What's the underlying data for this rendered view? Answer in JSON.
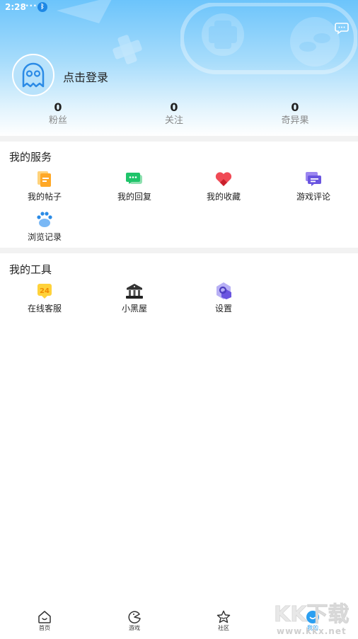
{
  "status_bar": {
    "time": "2:28",
    "dots": "···",
    "bluetooth_icon": "bluetooth-icon"
  },
  "header": {
    "message_icon": "chat-bubble-icon",
    "login_text": "点击登录",
    "avatar_icon": "ghost-icon"
  },
  "stats": [
    {
      "value": "0",
      "label": "粉丝"
    },
    {
      "value": "0",
      "label": "关注"
    },
    {
      "value": "0",
      "label": "奇异果"
    }
  ],
  "services": {
    "title": "我的服务",
    "items": [
      {
        "label": "我的帖子",
        "icon": "document-icon"
      },
      {
        "label": "我的回复",
        "icon": "reply-bubble-icon"
      },
      {
        "label": "我的收藏",
        "icon": "heart-icon"
      },
      {
        "label": "游戏评论",
        "icon": "comment-icon"
      },
      {
        "label": "浏览记录",
        "icon": "paw-icon"
      }
    ]
  },
  "tools": {
    "title": "我的工具",
    "items": [
      {
        "label": "在线客服",
        "icon": "customer-service-24-icon",
        "badge": "24"
      },
      {
        "label": "小黑屋",
        "icon": "bank-building-icon"
      },
      {
        "label": "设置",
        "icon": "settings-hexagon-icon"
      }
    ]
  },
  "tabbar": {
    "items": [
      {
        "label": "首页",
        "icon": "home-face-icon",
        "active": false
      },
      {
        "label": "游戏",
        "icon": "game-pacman-icon",
        "active": false
      },
      {
        "label": "社区",
        "icon": "star-icon",
        "active": false
      },
      {
        "label": "我的",
        "icon": "profile-face-icon",
        "active": true
      }
    ]
  },
  "watermark": {
    "big": "KK下载",
    "small": "www.kkx.net"
  },
  "colors": {
    "accent": "#2b9ff1",
    "divider": "#f2f2f2",
    "header_top": "#6cc4fb"
  }
}
